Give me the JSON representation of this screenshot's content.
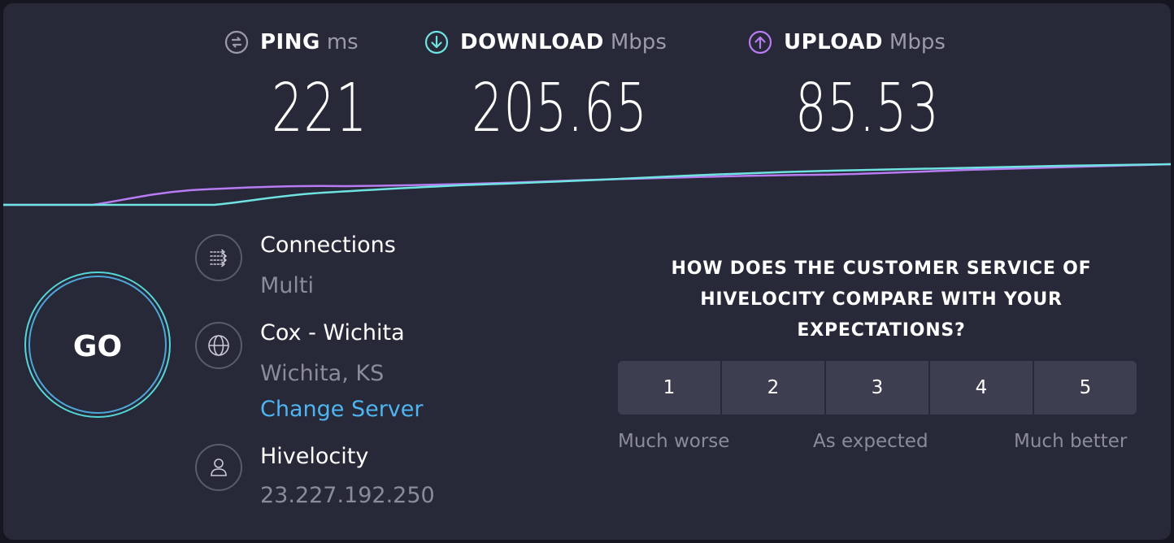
{
  "metrics": {
    "ping": {
      "name": "PING",
      "unit": "ms",
      "value": "221",
      "icon": "ping-icon",
      "color": "#9a9aa8"
    },
    "download": {
      "name": "DOWNLOAD",
      "unit": "Mbps",
      "value": "205.65",
      "icon": "download-arrow-icon",
      "color": "#6fe3e1"
    },
    "upload": {
      "name": "UPLOAD",
      "unit": "Mbps",
      "value": "85.53",
      "icon": "upload-arrow-icon",
      "color": "#b77cf2"
    }
  },
  "go_button": {
    "label": "GO"
  },
  "connection": {
    "connections": {
      "title": "Connections",
      "value": "Multi",
      "icon": "connections-icon"
    },
    "server": {
      "title": "Cox - Wichita",
      "location": "Wichita, KS",
      "change_label": "Change Server",
      "icon": "globe-icon"
    },
    "provider": {
      "title": "Hivelocity",
      "ip": "23.227.192.250",
      "icon": "user-icon"
    }
  },
  "survey": {
    "question": "HOW DOES THE CUSTOMER SERVICE OF HIVELOCITY COMPARE WITH YOUR EXPECTATIONS?",
    "options": [
      "1",
      "2",
      "3",
      "4",
      "5"
    ],
    "scale_low": "Much worse",
    "scale_mid": "As expected",
    "scale_high": "Much better"
  },
  "colors": {
    "background": "#272838",
    "download_line": "#6fe3e1",
    "upload_line": "#b77cf2",
    "link": "#4fb4f0"
  }
}
